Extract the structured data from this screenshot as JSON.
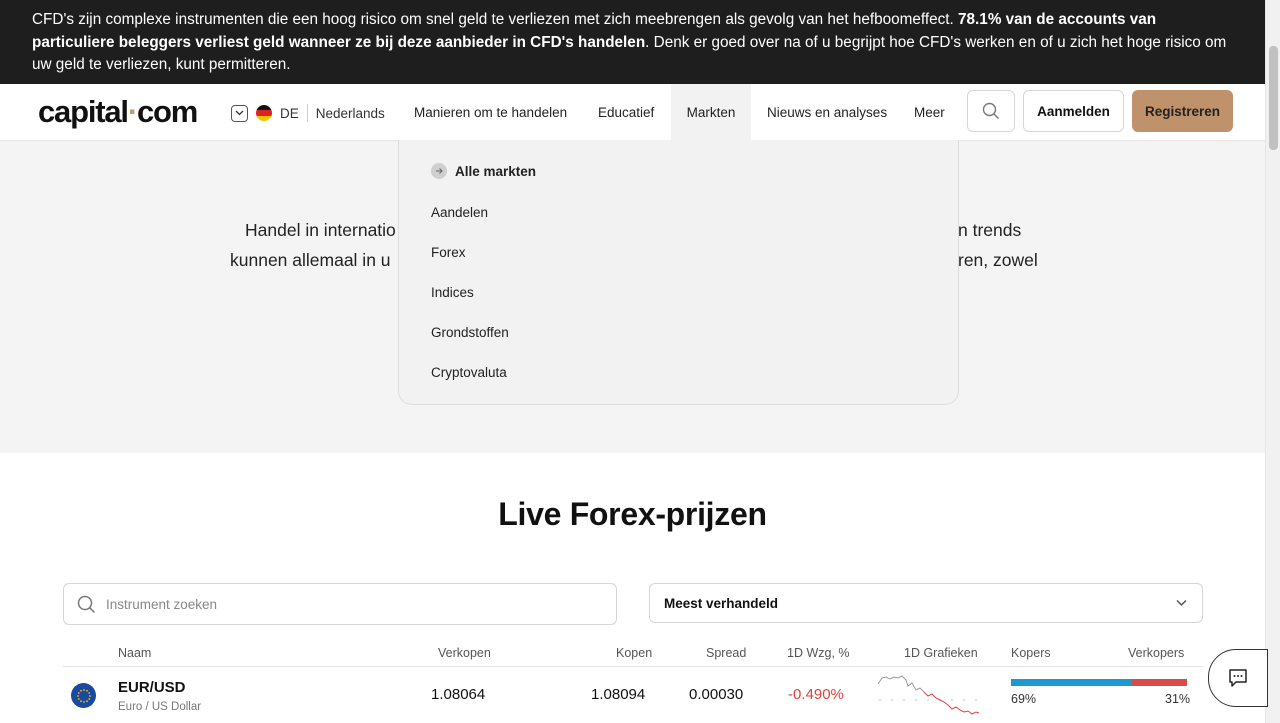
{
  "banner": {
    "text_part1": "CFD's zijn complexe instrumenten die een hoog risico om snel geld te verliezen met zich meebrengen als gevolg van het hefboomeffect. ",
    "text_bold": "78.1% van de accounts van particuliere beleggers verliest geld wanneer ze bij deze aanbieder in CFD's handelen",
    "text_part2": ". Denk er goed over na of u begrijpt hoe CFD's werken en of u zich het hoge risico om uw geld te verliezen, kunt permitteren."
  },
  "header": {
    "logo_text_1": "capital",
    "logo_dot": "·",
    "logo_text_2": "com",
    "country_code": "DE",
    "language": "Nederlands",
    "nav": [
      "Manieren om te handelen",
      "Educatief",
      "Markten",
      "Nieuws en analyses",
      "Meer"
    ],
    "active_nav": "Markten",
    "login_label": "Aanmelden",
    "register_label": "Registreren"
  },
  "dropdown": {
    "all_label": "Alle markten",
    "items": [
      "Aandelen",
      "Forex",
      "Indices",
      "Grondstoffen",
      "Cryptovaluta"
    ]
  },
  "hero": {
    "line1_left": "Handel in internatio",
    "line1_right": "n trends",
    "line2_left": "kunnen allemaal in u",
    "line2_right": "ren, zowel"
  },
  "main": {
    "title": "Live Forex-prijzen",
    "search_placeholder": "Instrument zoeken",
    "sort_selected": "Meest verhandeld",
    "columns": [
      "Naam",
      "Verkopen",
      "Kopen",
      "Spread",
      "1D Wzg, %",
      "1D Grafieken",
      "Kopers",
      "Verkopers"
    ],
    "rows": [
      {
        "symbol": "EUR/USD",
        "description": "Euro / US Dollar",
        "sell": "1.08064",
        "buy": "1.08094",
        "spread": "0.00030",
        "change": "-0.490%",
        "buyers_pct": "69%",
        "sellers_pct": "31%",
        "buyers_fraction": 0.69
      }
    ]
  },
  "colors": {
    "banner_bg": "#1e1e1e",
    "accent": "#c0926b",
    "negative": "#e0423b",
    "buyers": "#1b9ad1",
    "sellers": "#d94a4a"
  }
}
